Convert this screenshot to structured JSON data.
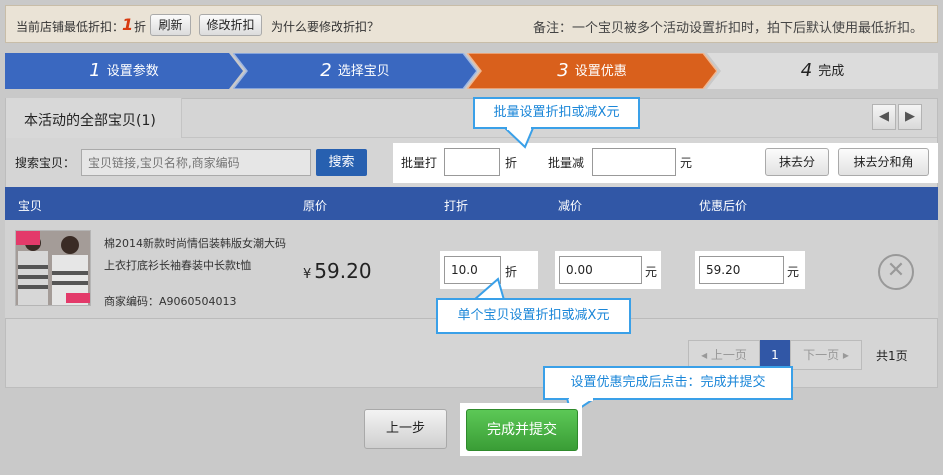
{
  "notice": {
    "label": "当前店铺最低折扣：",
    "min_discount": "1",
    "unit": "折",
    "refresh_button": "刷新",
    "edit_button": "修改折扣",
    "why_link": "为什么要修改折扣？",
    "remark": "备注：一个宝贝被多个活动设置折扣时，拍下后默认使用最低折扣。"
  },
  "steps": [
    {
      "num": "1",
      "label": "设置参数",
      "state": "done",
      "color": "#3a68c0"
    },
    {
      "num": "2",
      "label": "选择宝贝",
      "state": "done",
      "color": "#3a68c0"
    },
    {
      "num": "3",
      "label": "设置优惠",
      "state": "current",
      "color": "#d9601c"
    },
    {
      "num": "4",
      "label": "完成",
      "state": "todo",
      "color": "#dcdcdc"
    }
  ],
  "tab": {
    "label": "本活动的全部宝贝",
    "count": "(1)"
  },
  "nav": {
    "prev_icon": "chevron-left-icon",
    "next_icon": "chevron-right-icon"
  },
  "search": {
    "label": "搜索宝贝：",
    "placeholder": "宝贝链接,宝贝名称,商家编码",
    "button": "搜索"
  },
  "batch": {
    "discount_label": "批量打",
    "discount_unit": "折",
    "reduce_label": "批量减",
    "reduce_unit": "元",
    "round_fen_button": "抹去分",
    "round_fen_jiao_button": "抹去分和角"
  },
  "table": {
    "headers": [
      "宝贝",
      "原价",
      "打折",
      "减价",
      "优惠后价"
    ],
    "rows": [
      {
        "title_line1": "棉2014新款时尚情侣装韩版女潮大码",
        "title_line2": "上衣打底衫长袖春装中长款t恤",
        "sku": "商家编码：A9060504013",
        "currency": "¥",
        "price": "59.20",
        "discount": "10.0",
        "discount_unit": "折",
        "reduce": "0.00",
        "reduce_unit": "元",
        "final_price": "59.20",
        "final_unit": "元"
      }
    ]
  },
  "pagination": {
    "prev": "上一页",
    "current": "1",
    "next": "下一页",
    "total": "共1页"
  },
  "callouts": {
    "batch": "批量设置折扣或减X元",
    "single": "单个宝贝设置折扣或减X元",
    "finish": "设置优惠完成后点击：完成并提交"
  },
  "footer": {
    "prev_button": "上一步",
    "finish_button": "完成并提交"
  },
  "colors": {
    "accent_blue": "#3157a6",
    "current_step": "#d9601c",
    "finish_green": "#3a9d36",
    "callout_blue": "#3aa0e8"
  }
}
